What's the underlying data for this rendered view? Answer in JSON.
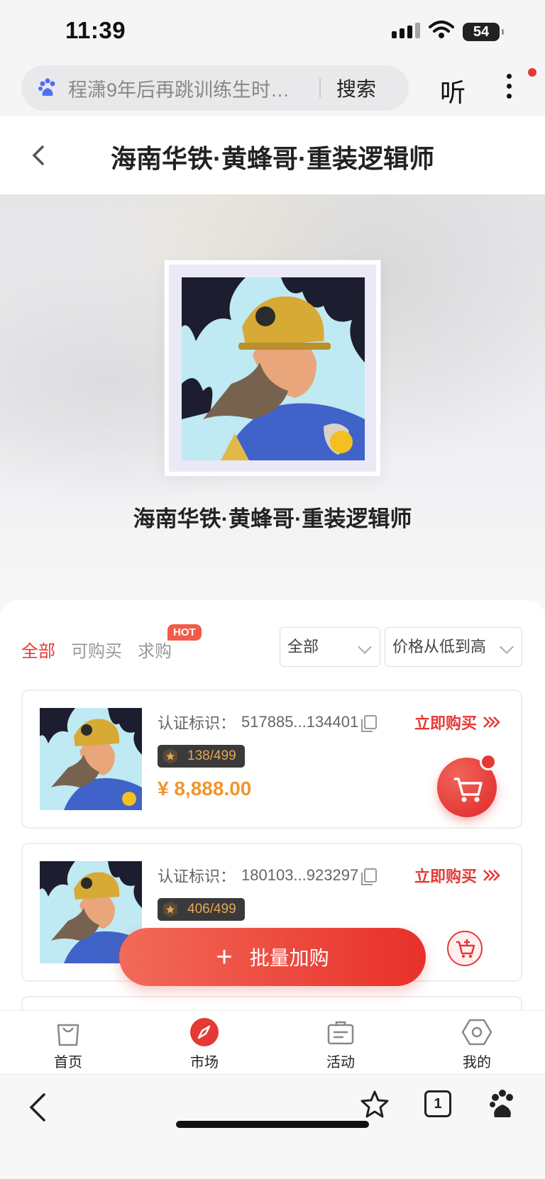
{
  "status": {
    "time": "11:39",
    "battery": "54"
  },
  "search": {
    "query": "程潇9年后再跳训练生时…",
    "button": "搜索",
    "listen": "听"
  },
  "header": {
    "title": "海南华铁·黄蜂哥·重装逻辑师"
  },
  "hero": {
    "name": "海南华铁·黄蜂哥·重装逻辑师"
  },
  "filters": {
    "tabs": [
      "全部",
      "可购买",
      "求购"
    ],
    "active_tab": "全部",
    "hot_badge": "HOT",
    "category_select": "全部",
    "sort_select": "价格从低到高"
  },
  "listings": [
    {
      "cert_label": "认证标识：",
      "cert_id": "517885...134401",
      "buy_label": "立即购买",
      "serial": "138/499",
      "price": "¥ 8,888.00"
    },
    {
      "cert_label": "认证标识：",
      "cert_id": "180103...923297",
      "buy_label": "立即购买",
      "serial": "406/499",
      "price": ""
    }
  ],
  "batch_button": "批量加购",
  "app_tabs": [
    {
      "label": "首页",
      "icon": "bag-icon"
    },
    {
      "label": "市场",
      "icon": "compass-icon"
    },
    {
      "label": "活动",
      "icon": "briefcase-icon"
    },
    {
      "label": "我的",
      "icon": "hexagon-icon"
    }
  ],
  "browser": {
    "tab_count": "1"
  },
  "colors": {
    "accent": "#e53935",
    "price": "#f0962e",
    "serial_text": "#e8a55a"
  }
}
